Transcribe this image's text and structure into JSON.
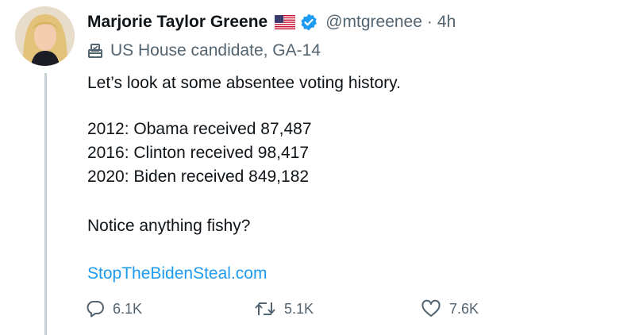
{
  "author": {
    "display_name": "Marjorie Taylor Greene",
    "handle": "@mtgreenee",
    "separator": "·",
    "time": "4h",
    "label": "US House candidate, GA-14",
    "flag_icon": "us-flag-icon",
    "verified_icon": "verified-badge-icon",
    "label_icon": "ballot-box-icon"
  },
  "tweet": {
    "lines": [
      "Let’s look at some absentee voting history.",
      "2012: Obama received 87,487",
      "2016: Clinton received 98,417",
      "2020: Biden received 849,182",
      "Notice anything fishy?"
    ],
    "link": "StopTheBidenSteal.com"
  },
  "actions": {
    "replies": {
      "icon": "reply-icon",
      "count": "6.1K"
    },
    "retweets": {
      "icon": "retweet-icon",
      "count": "5.1K"
    },
    "likes": {
      "icon": "heart-icon",
      "count": "7.6K"
    }
  },
  "colors": {
    "text": "#0f1419",
    "secondary": "#536471",
    "link": "#1d9bf0",
    "verified": "#1d9bf0"
  }
}
